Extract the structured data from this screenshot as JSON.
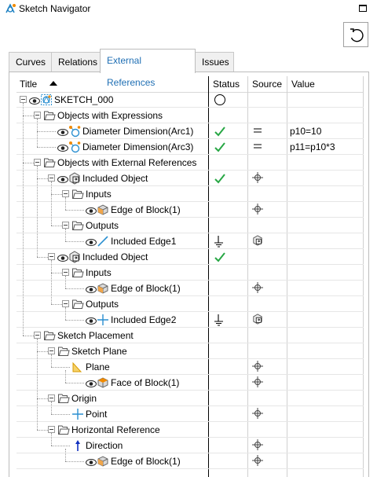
{
  "window": {
    "title": "Sketch Navigator"
  },
  "tabs": [
    {
      "label": "Curves"
    },
    {
      "label": "Relations"
    },
    {
      "label": "External References"
    },
    {
      "label": "Issues"
    }
  ],
  "columns": {
    "title": "Title",
    "status": "Status",
    "source": "Source",
    "value": "Value"
  },
  "rows": [
    {
      "label": "SKETCH_000",
      "value": ""
    },
    {
      "label": "Objects with Expressions",
      "value": ""
    },
    {
      "label": "Diameter Dimension(Arc1)",
      "value": "p10=10"
    },
    {
      "label": "Diameter Dimension(Arc3)",
      "value": "p11=p10*3"
    },
    {
      "label": "Objects with External References",
      "value": ""
    },
    {
      "label": "Included Object",
      "value": ""
    },
    {
      "label": "Inputs",
      "value": ""
    },
    {
      "label": "Edge of Block(1)",
      "value": ""
    },
    {
      "label": "Outputs",
      "value": ""
    },
    {
      "label": "Included Edge1",
      "value": ""
    },
    {
      "label": "Included Object",
      "value": ""
    },
    {
      "label": "Inputs",
      "value": ""
    },
    {
      "label": "Edge of Block(1)",
      "value": ""
    },
    {
      "label": "Outputs",
      "value": ""
    },
    {
      "label": "Included Edge2",
      "value": ""
    },
    {
      "label": "Sketch Placement",
      "value": ""
    },
    {
      "label": "Sketch Plane",
      "value": ""
    },
    {
      "label": "Plane",
      "value": ""
    },
    {
      "label": "Face of Block(1)",
      "value": ""
    },
    {
      "label": "Origin",
      "value": ""
    },
    {
      "label": "Point",
      "value": ""
    },
    {
      "label": "Horizontal Reference",
      "value": ""
    },
    {
      "label": "Direction",
      "value": ""
    },
    {
      "label": "Edge of Block(1)",
      "value": ""
    }
  ]
}
